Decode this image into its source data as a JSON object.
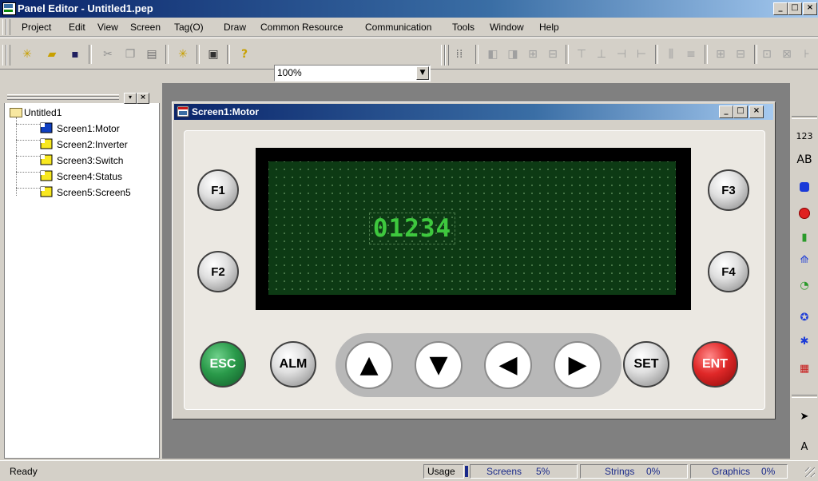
{
  "app": {
    "title": "Panel Editor - Untitled1.pep",
    "caption_buttons": [
      "_",
      "□",
      "×"
    ]
  },
  "menu": [
    "Project",
    "Edit",
    "View",
    "Screen",
    "Tag(O)",
    "Draw",
    "Common Resource",
    "Communication",
    "Tools",
    "Window",
    "Help"
  ],
  "toolbar": {
    "zoom": "100%"
  },
  "tree": {
    "root": "Untitled1",
    "items": [
      "Screen1:Motor",
      "Screen2:Inverter",
      "Screen3:Switch",
      "Screen4:Status",
      "Screen5:Screen5"
    ]
  },
  "child_window": {
    "title": "Screen1:Motor",
    "caption_buttons": [
      "_",
      "□",
      "×"
    ]
  },
  "panel": {
    "lcd_value": "01234",
    "fkeys": [
      "F1",
      "F2",
      "F3",
      "F4"
    ],
    "keys": {
      "esc": "ESC",
      "alm": "ALM",
      "set": "SET",
      "ent": "ENT"
    },
    "arrows": [
      "▲",
      "▼",
      "◀",
      "▶"
    ]
  },
  "right_toolbar": {
    "numeric": "123",
    "text": "AB",
    "text_small": "A"
  },
  "status": {
    "ready": "Ready",
    "usage_label": "Usage",
    "screens_label": "Screens",
    "screens_value": "5%",
    "strings_label": "Strings",
    "strings_value": "0%",
    "graphics_label": "Graphics",
    "graphics_value": "0%"
  },
  "colors": {
    "title_start": "#0a246a",
    "lcd_bg": "#0d3a14",
    "lcd_text": "#3ec83e",
    "esc": "#1f7a3a",
    "ent": "#c81818"
  }
}
